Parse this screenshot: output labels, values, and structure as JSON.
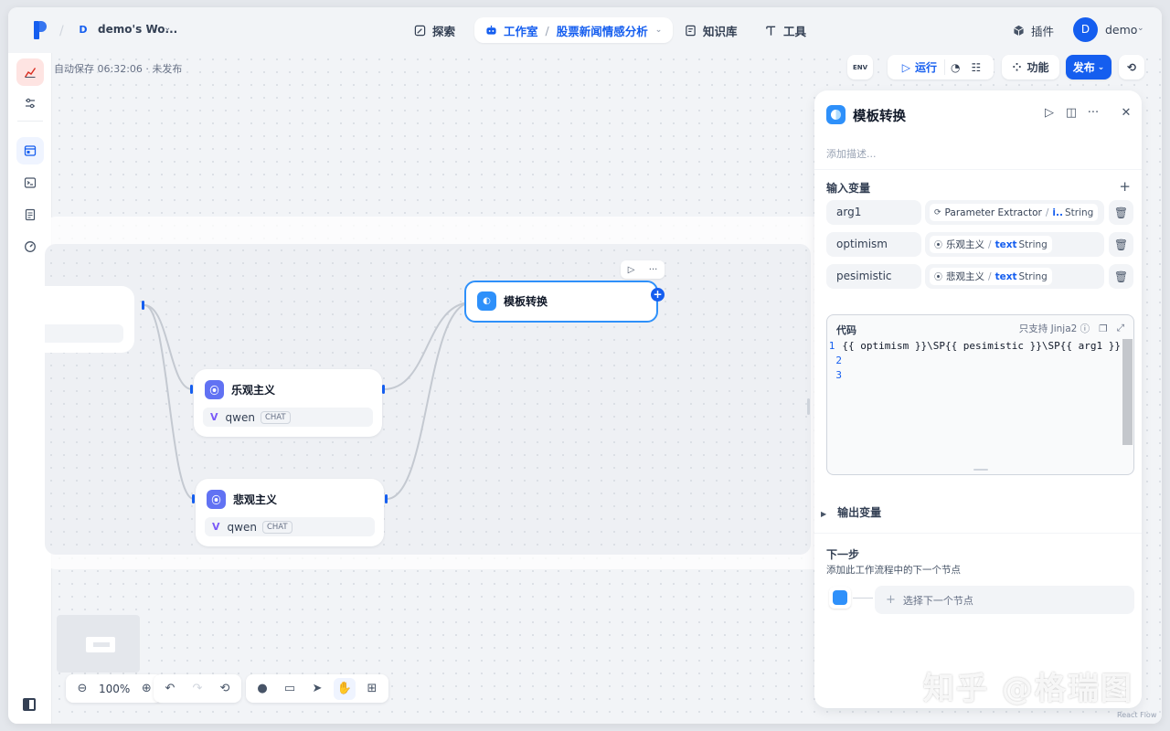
{
  "workspace": {
    "avatar": "D",
    "name": "demo's Wo..."
  },
  "nav": {
    "explore": "探索",
    "studio": "工作室",
    "app_name": "股票新闻情感分析",
    "knowledge": "知识库",
    "tools": "工具",
    "plugins": "插件"
  },
  "user": {
    "avatar": "D",
    "name": "demo"
  },
  "autosave": "自动保存 06:32:06 · 未发布",
  "header_buttons": {
    "env": "ENV",
    "run": "运行",
    "feature": "功能",
    "publish": "发布"
  },
  "nodes": {
    "optimism": {
      "title": "乐观主义",
      "model": "qwen",
      "mode": "CHAT"
    },
    "pessimism": {
      "title": "悲观主义",
      "model": "qwen",
      "mode": "CHAT"
    },
    "template": {
      "title": "模板转换"
    }
  },
  "zoom": "100%",
  "panel": {
    "title": "模板转换",
    "desc_placeholder": "添加描述...",
    "input_vars_title": "输入变量",
    "variables": [
      {
        "name": "arg1",
        "source": "Parameter Extractor",
        "var": "i..",
        "type": "String"
      },
      {
        "name": "optimism",
        "source": "乐观主义",
        "var": "text",
        "type": "String"
      },
      {
        "name": "pesimistic",
        "source": "悲观主义",
        "var": "text",
        "type": "String"
      }
    ],
    "code": {
      "label": "代码",
      "jinja_hint": "只支持 Jinja2",
      "lines": [
        "{{ optimism }}\\SP{{ pesimistic }}\\SP{{ arg1 }}",
        "",
        ""
      ],
      "line_numbers": [
        "1",
        "2",
        "3"
      ]
    },
    "output_vars_title": "输出变量",
    "next_step_title": "下一步",
    "next_step_desc": "添加此工作流程中的下一个节点",
    "next_step_select": "选择下一个节点"
  },
  "watermark": "知乎 @格瑞图",
  "attribution": "React Flow",
  "colors": {
    "accent": "#155eef",
    "node_icon_purple": "#6172f3",
    "node_icon_blue": "#2e90fa"
  }
}
